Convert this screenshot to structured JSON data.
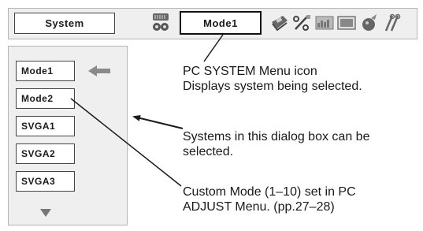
{
  "menu_bar": {
    "system_label": "System",
    "mode_label": "Mode1",
    "icons": [
      "input-source-icon",
      "pc-adjust-icon",
      "image-select-icon",
      "image-adjust-icon",
      "screen-icon",
      "setting-icon",
      "option-icon"
    ]
  },
  "system_list": {
    "items": [
      "Mode1",
      "Mode2",
      "SVGA1",
      "SVGA2",
      "SVGA3"
    ],
    "selected_index": 0,
    "scroll_down_icon": "triangle-down-icon"
  },
  "callouts": {
    "pc_system_icon": {
      "line1": "PC SYSTEM Menu icon",
      "line2": "Displays system being selected."
    },
    "systems_dialog": {
      "line1": "Systems in this dialog box can be",
      "line2": "selected."
    },
    "custom_mode": {
      "line1": "Custom Mode (1–10) set in PC",
      "line2": "ADJUST Menu. (pp.27–28)"
    }
  },
  "colors": {
    "panel_bg": "#efefef",
    "border": "#444444",
    "arrow": "#8a8a8a"
  }
}
